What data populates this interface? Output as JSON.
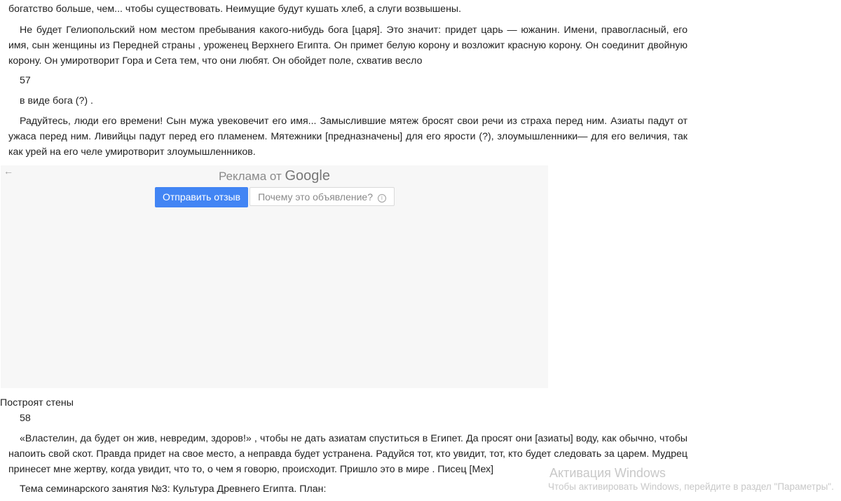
{
  "paragraphs": {
    "p1": "богатство больше, чем... чтобы существовать. Неимущие будут кушать хлеб, а слуги возвышены.",
    "p2": "Не будет Гелиопольский ном местом пребывания какого-нибудь бога [царя]. Это значит: придет царь — южанин. Имени, правогласный, его имя, сын женщины из Передней страны , уроженец Верхнего Египта. Он примет белую корону и возложит красную корону. Он соединит двойную корону. Он умиротворит Гора и Сета тем, что они любят. Он обойдет поле, схватив весло",
    "page57": "57",
    "p3": "в виде бога (?) .",
    "p4": "Радуйтесь, люди его времени! Сын мужа увековечит его имя... Замыслившие мятеж бросят свои речи из страха перед ним. Азиаты падут от ужаса перед ним. Ливийцы падут перед его пламенем. Мятежники [предназначены] для его ярости (?), злоумышленники— для его величия, так как урей на его челе умиротворит злоумышленников.",
    "p5": "Построят стены",
    "page58": "58",
    "p6": "«Властелин, да будет он жив, невредим, здоров!» , чтобы не дать азиатам спуститься в Египет. Да просят они [азиаты] воду, как обычно, чтобы напоить свой скот. Правда придет на свое место, а неправда будет устранена. Радуйся тот, кто увидит, тот, кто будет следовать за царем. Мудрец принесет мне жертву, когда увидит, что то, о чем я говорю, происходит. Пришло это в мире . Писец [Мех]",
    "p7": "Тема семинарского занятия №3: Культура Древнего Египта. План:"
  },
  "ad": {
    "back_icon": "←",
    "title_prefix": "Реклама от",
    "title_brand": "Google",
    "feedback_button": "Отправить отзыв",
    "why_button": "Почему это объявление?",
    "info_icon": "i"
  },
  "watermark": {
    "title": "Активация Windows",
    "subtitle": "Чтобы активировать Windows, перейдите в раздел \"Параметры\"."
  },
  "colors": {
    "feedback_button_bg": "#4285f4",
    "ad_background": "#f7f7f7"
  }
}
